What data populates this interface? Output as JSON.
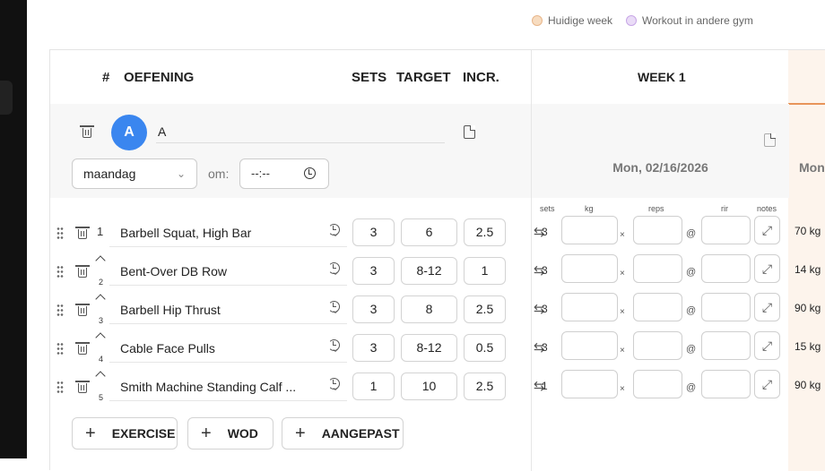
{
  "legend": [
    {
      "label": "Huidige week",
      "color": "#f7dcc0",
      "border": "#e8b68a"
    },
    {
      "label": "Workout in andere gym",
      "color": "#eadcf7",
      "border": "#c7a6e6"
    }
  ],
  "headers": {
    "num": "#",
    "exercise": "OEFENING",
    "sets": "SETS",
    "target": "TARGET",
    "incr": "INCR.",
    "week": "WEEK 1"
  },
  "day": {
    "avatar_letter": "A",
    "name": "A",
    "weekday": "maandag",
    "time_label": "om:",
    "time_value": "--:--"
  },
  "week": {
    "date": "Mon, 02/16/2026",
    "next_date": "Mon"
  },
  "log_headers": {
    "sets": "sets",
    "kg": "kg",
    "reps": "reps",
    "rir": "rir",
    "notes": "notes"
  },
  "exercises": [
    {
      "num": "1",
      "name": "Barbell Squat, High Bar",
      "sets": "3",
      "target": "6",
      "incr": "2.5",
      "log_sets": "3",
      "prev": "70 kg"
    },
    {
      "num": "2",
      "name": "Bent-Over DB Row",
      "sets": "3",
      "target": "8-12",
      "incr": "1",
      "log_sets": "3",
      "prev": "14 kg"
    },
    {
      "num": "3",
      "name": "Barbell Hip Thrust",
      "sets": "3",
      "target": "8",
      "incr": "2.5",
      "log_sets": "3",
      "prev": "90 kg"
    },
    {
      "num": "4",
      "name": "Cable Face Pulls",
      "sets": "3",
      "target": "8-12",
      "incr": "0.5",
      "log_sets": "3",
      "prev": "15 kg"
    },
    {
      "num": "5",
      "name": "Smith Machine Standing Calf ...",
      "sets": "1",
      "target": "10",
      "incr": "2.5",
      "log_sets": "1",
      "prev": "90 kg"
    }
  ],
  "buttons": {
    "exercise": "EXERCISE",
    "wod": "WOD",
    "custom": "AANGEPAST"
  },
  "glyphs": {
    "times": "×",
    "at": "@",
    "expand": "⤢",
    "swap": "⇆",
    "chevron": "⌄",
    "plus": "+"
  }
}
